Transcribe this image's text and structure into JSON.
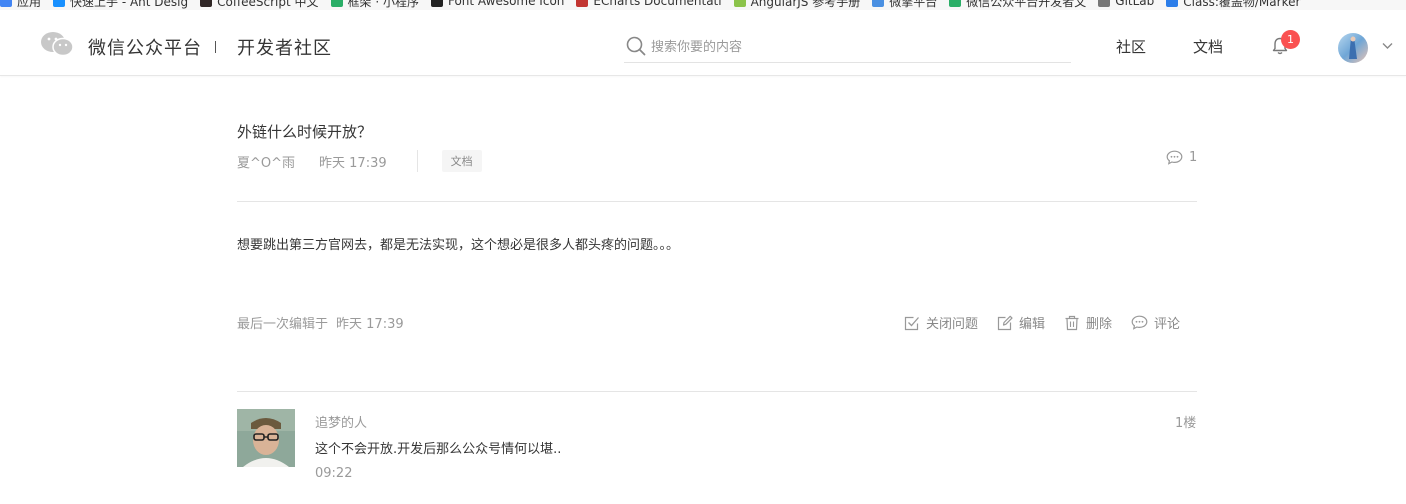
{
  "bookmarks": [
    {
      "label": "应用",
      "color": "#4285f4",
      "icon": "apps-icon"
    },
    {
      "label": "快速上手 - Ant Desig",
      "color": "#1890ff",
      "icon": "ant-design-icon"
    },
    {
      "label": "CoffeeScript 中文",
      "color": "#2f2625",
      "icon": "coffeescript-icon"
    },
    {
      "label": "框架 · 小程序",
      "color": "#2aae67",
      "icon": "wechat-icon"
    },
    {
      "label": "Font Awesome Icon",
      "color": "#222222",
      "icon": "font-awesome-icon"
    },
    {
      "label": "ECharts Documentati",
      "color": "#c23531",
      "icon": "echarts-icon"
    },
    {
      "label": "AngularJS 参考手册",
      "color": "#8bc34a",
      "icon": "angularjs-icon"
    },
    {
      "label": "微擎平台",
      "color": "#4a90e2",
      "icon": "cloud-icon"
    },
    {
      "label": "微信公众平台开发者文",
      "color": "#2aae67",
      "icon": "wechat-icon"
    },
    {
      "label": "GitLab",
      "color": "#777777",
      "icon": "gitlab-icon"
    },
    {
      "label": "Class:覆盖物/Marker",
      "color": "#2b7de9",
      "icon": "map-icon"
    }
  ],
  "header": {
    "brand": "微信公众平台",
    "sub": "开发者社区",
    "search_placeholder": "搜索你要的内容",
    "nav": {
      "community": "社区",
      "docs": "文档"
    },
    "notification_count": "1",
    "logo_color": "#c8c8c8"
  },
  "question": {
    "title": "外链什么时候开放？",
    "author": "夏^O^雨",
    "time": "昨天 17:39",
    "tag": "文档",
    "comment_count": "1",
    "body": "想要跳出第三方官网去，都是无法实现，这个想必是很多人都头疼的问题。。。",
    "edited_label": "最后一次编辑于",
    "edited_time": "昨天 17:39",
    "actions": {
      "close": "关闭问题",
      "edit": "编辑",
      "delete": "删除",
      "comment": "评论"
    }
  },
  "reply": {
    "author": "追梦的人",
    "floor": "1楼",
    "text": "这个不会开放.开发后那么公众号情何以堪..",
    "time": "09:22"
  }
}
